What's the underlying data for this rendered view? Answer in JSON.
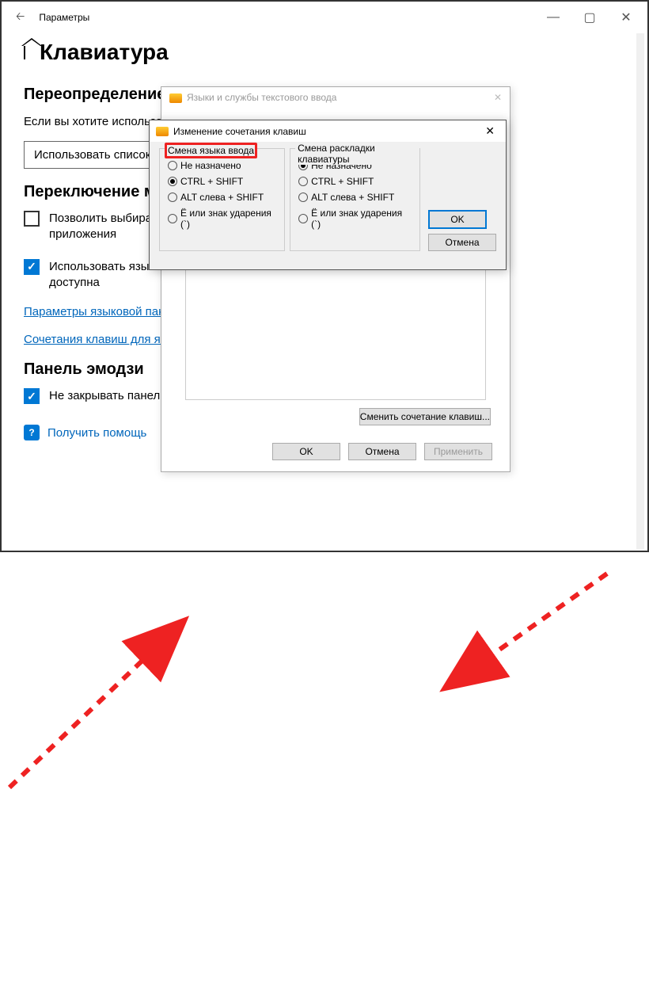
{
  "window": {
    "title": "Параметры"
  },
  "page": {
    "title": "Клавиатура",
    "section_override": "Переопределение",
    "override_body": "Если вы хотите использовать… на первом месте в вашем с…",
    "override_button": "Использовать список я",
    "section_switch": "Переключение м",
    "chk_allow": "Позволить выбирать м\nприложения",
    "chk_use_lang": "Использовать языкову\nдоступна",
    "link_panel": "Параметры языковой пане",
    "link_hotkeys": "Сочетания клавиш для язы",
    "section_emoji": "Панель эмодзи",
    "chk_emoji": "Не закрывать панель автоматически после ввода эмодзи",
    "help": "Получить помощь"
  },
  "dlg1": {
    "title": "Языки и службы текстового ввода",
    "change_btn": "Сменить сочетание клавиш...",
    "ok": "OK",
    "cancel": "Отмена",
    "apply": "Применить"
  },
  "dlg2": {
    "title": "Изменение сочетания клавиш",
    "left_legend": "Смена языка ввода",
    "right_legend": "Смена раскладки клавиатуры",
    "opt_none": "Не назначено",
    "opt_ctrl": "CTRL + SHIFT",
    "opt_alt": "ALT слева + SHIFT",
    "opt_e": "Ё или знак ударения (`)",
    "ok": "OK",
    "cancel": "Отмена"
  }
}
